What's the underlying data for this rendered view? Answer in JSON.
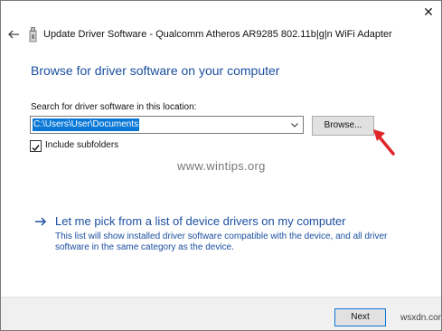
{
  "window": {
    "title": "Update Driver Software - Qualcomm Atheros AR9285 802.11b|g|n WiFi Adapter",
    "close_glyph": "✕"
  },
  "main": {
    "heading": "Browse for driver software on your computer",
    "search_label": "Search for driver software in this location:",
    "path_value": "C:\\Users\\User\\Documents",
    "browse_label": "Browse...",
    "include_subfolders_label": "Include subfolders",
    "include_subfolders_checked": true,
    "pick_title": "Let me pick from a list of device drivers on my computer",
    "pick_description": "This list will show installed driver software compatible with the device, and all driver software in the same category as the device."
  },
  "footer": {
    "next_label": "Next",
    "watermark_corner": "wsxdn.com"
  },
  "overlay": {
    "watermark": "www.wintips.org"
  },
  "colors": {
    "accent": "#1b4fa0",
    "selection": "#0a78d7",
    "annotation_arrow": "#e0252b"
  },
  "icons": {
    "back": "back-arrow-icon",
    "device": "usb-device-icon",
    "combo_dropdown": "chevron-down-icon",
    "link_arrow": "right-arrow-icon",
    "annotation": "red-pointer-arrow-icon"
  }
}
